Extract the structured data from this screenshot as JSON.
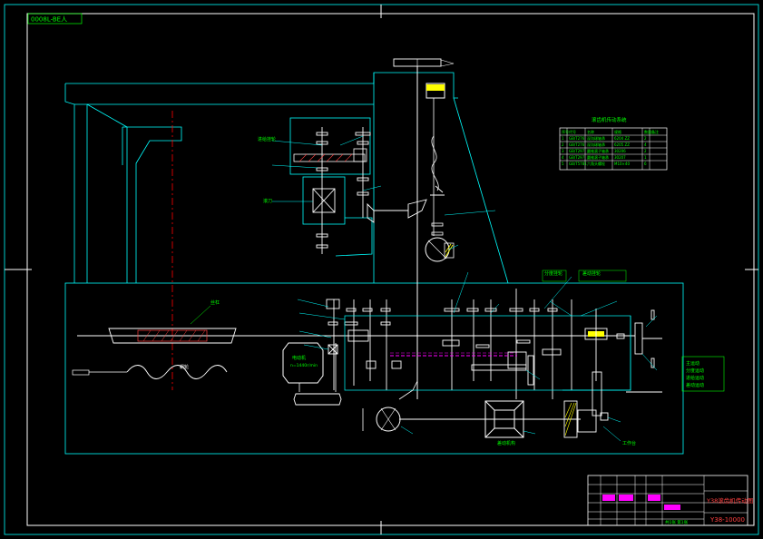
{
  "drawing": {
    "stamp": "0008L-BE人",
    "title_block": {
      "drawing_name": "Y38滚齿机传动图",
      "drawing_number": "Y38-10000",
      "sheet": "共1张 第1张"
    },
    "parts_table": {
      "title": "滚齿机传动系统",
      "headers": [
        "序号",
        "代号",
        "名称",
        "规格",
        "数量",
        "备注"
      ],
      "rows": [
        [
          "1",
          "GB/T276",
          "深沟球轴承",
          "6204 ZZ",
          "2",
          ""
        ],
        [
          "2",
          "GB/T276",
          "深沟球轴承",
          "6205 ZZ",
          "4",
          ""
        ],
        [
          "3",
          "GB/T297",
          "圆锥滚子轴承",
          "30206",
          "2",
          ""
        ],
        [
          "4",
          "GB/T297",
          "圆锥滚子轴承",
          "30207",
          "1",
          ""
        ],
        [
          "5",
          "GB/T5781",
          "六角头螺栓",
          "M10×40",
          "6",
          ""
        ]
      ]
    },
    "labels": {
      "feed_screw": "丝杠",
      "motor": "电动机",
      "motor_spec": "n=1440r/min",
      "worm_wheel": "蜗轮",
      "differential": "差动机构",
      "change_gears_1": "分度挂轮",
      "change_gears_2": "差动挂轮",
      "feed_change_gears": "进给挂轮",
      "hob": "滚刀",
      "work_table": "工作台",
      "note_speed": "主运动",
      "note_index": "分度运动",
      "note_feed": "进给运动",
      "note_diff": "差动运动"
    },
    "colors": {
      "frame": "#ffffff",
      "outline": "#00ffff",
      "shaft": "#ffffff",
      "center_line": "#ff0000",
      "label": "#00ff00",
      "highlight": "#ffff00",
      "hatch": "#ff4040",
      "accent": "#ff00ff"
    }
  }
}
